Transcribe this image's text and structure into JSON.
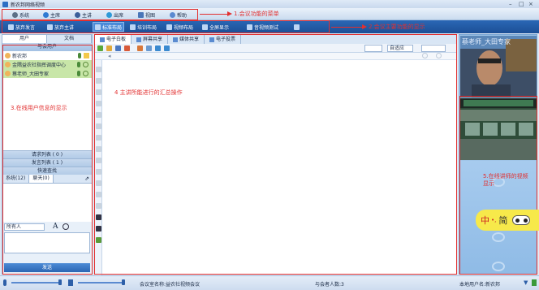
{
  "window": {
    "title": "新农邦网络视频",
    "minimize": "–",
    "maximize": "□",
    "close": "×"
  },
  "menu": {
    "items": [
      {
        "label": "系统",
        "icon": "gear-icon"
      },
      {
        "label": "主席",
        "icon": "chair-icon"
      },
      {
        "label": "主讲",
        "icon": "presenter-icon"
      },
      {
        "label": "出席",
        "icon": "attend-icon"
      },
      {
        "label": "视图",
        "icon": "view-icon"
      },
      {
        "label": "帮助",
        "icon": "help-icon"
      }
    ]
  },
  "toolbar": {
    "items": [
      {
        "label": "放弃发言"
      },
      {
        "label": "放弃主讲"
      },
      {
        "label": "标准布局"
      },
      {
        "label": "培训布局"
      },
      {
        "label": "视频布局"
      },
      {
        "label": "全屏显示"
      },
      {
        "label": "音视频测试"
      },
      {
        "label": ""
      }
    ]
  },
  "annotations": {
    "menu": "1.会议功能的菜单",
    "toolbar": "2.会议主要功能的显示",
    "users": "3.在线用户信息的显示",
    "main": "4    主讲所能进行的汇总操作",
    "video": "5.在线讲师的视频显示"
  },
  "left_panel": {
    "tabs": [
      "用户",
      "文档"
    ],
    "header": "与会用户",
    "users": [
      {
        "name": "新农邦"
      },
      {
        "name": "金隅益农社指挥调度中心"
      },
      {
        "name": "蔡老师_大田专家"
      }
    ],
    "request_list": "请求列表 ( 0 )",
    "speak_list": "发言列表 ( 1 )",
    "quick_query": "快速查找",
    "chat_tabs": [
      "系统(12)",
      "聊天(0)"
    ],
    "chat_target": "所有人",
    "font_button": "A",
    "send_button": "发送"
  },
  "center": {
    "tabs": [
      "电子白板",
      "屏幕共享",
      "媒体共享",
      "电子投票"
    ],
    "zoom": "自适应",
    "page_select": ""
  },
  "right_panel": {
    "video_overlay": "蔡老师_大田专家"
  },
  "floatbar": {
    "text": "中",
    "dot": "•,",
    "label": "简"
  },
  "status": {
    "meeting": "会议室名称:益农社视频会议",
    "count": "与会者人数:3",
    "user": "本地用户名:新农邦"
  },
  "colors": {
    "annotation": "#e23030",
    "toolbar_bg": "#1c4f96",
    "selected_user": "#c8e6a8"
  }
}
